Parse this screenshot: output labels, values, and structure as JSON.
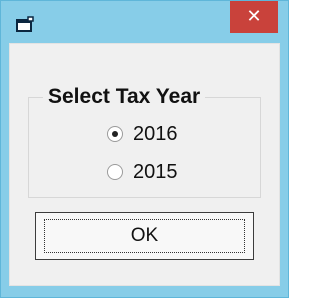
{
  "window": {
    "icon": "app-window-icon",
    "close_glyph": "✕",
    "colors": {
      "titlebar": "#87cde8",
      "close": "#c9423b",
      "client": "#f0f0f0"
    }
  },
  "dialog": {
    "group_title": "Select Tax Year",
    "options": [
      {
        "label": "2016",
        "checked": true
      },
      {
        "label": "2015",
        "checked": false
      }
    ],
    "ok_label": "OK"
  }
}
